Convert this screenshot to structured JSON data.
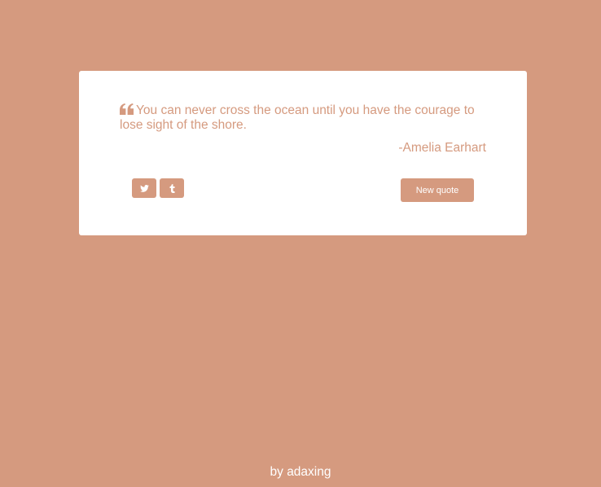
{
  "colors": {
    "background": "#d59a7f",
    "card": "#ffffff",
    "accent": "#d59a7f",
    "button_text": "#ffffff"
  },
  "quote": {
    "icon": "quote-left-icon",
    "text": "You can never cross the ocean until you have the courage to lose sight of the shore.",
    "author": "-Amelia Earhart"
  },
  "actions": {
    "twitter_icon": "twitter-icon",
    "tumblr_icon": "tumblr-icon",
    "new_quote_label": "New quote"
  },
  "footer": {
    "prefix": "by ",
    "author_link": "adaxing"
  }
}
